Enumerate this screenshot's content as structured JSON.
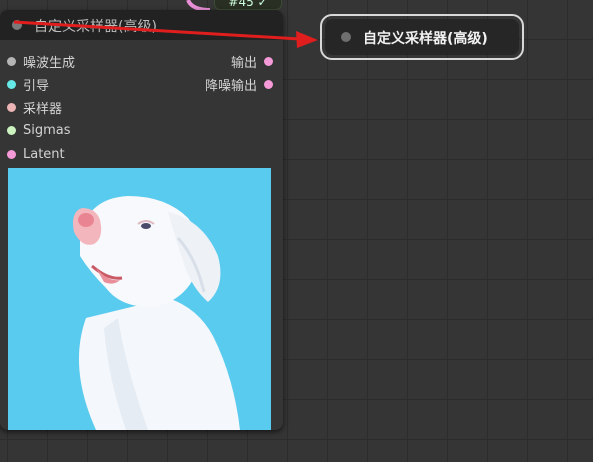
{
  "top_node": {
    "label": "#45 ✓"
  },
  "node": {
    "title": "自定义采样器(高级)",
    "inputs": [
      {
        "label": "噪波生成",
        "color": "#b5b5b5"
      },
      {
        "label": "引导",
        "color": "#66e8e6"
      },
      {
        "label": "采样器",
        "color": "#ecb4b4"
      },
      {
        "label": "Sigmas",
        "color": "#cdf3c1"
      },
      {
        "label": "Latent",
        "color": "#f59ad8"
      }
    ],
    "outputs": [
      {
        "label": "输出",
        "color": "#f59ad8"
      },
      {
        "label": "降噪输出",
        "color": "#f59ad8"
      }
    ],
    "preview_bg": "#59cbee"
  },
  "callout": {
    "label": "自定义采样器(高级)"
  },
  "annotation_arrow_color": "#e01e1e"
}
